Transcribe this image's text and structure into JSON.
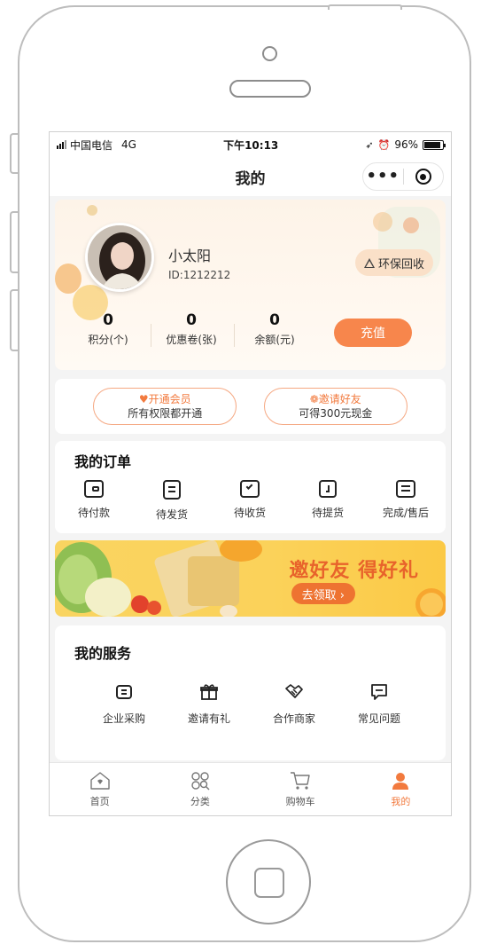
{
  "statusbar": {
    "carrier": "中国电信",
    "network": "4G",
    "time": "下午10:13",
    "battery": "96%"
  },
  "navbar": {
    "title": "我的",
    "more": "•••"
  },
  "profile": {
    "name": "小太阳",
    "id": "ID:1212212",
    "eco_button": "环保回收",
    "stats": [
      {
        "value": "0",
        "label": "积分(个)"
      },
      {
        "value": "0",
        "label": "优惠卷(张)"
      },
      {
        "value": "0",
        "label": "余额(元)"
      }
    ],
    "recharge": "充值"
  },
  "promos": [
    {
      "title": "♥开通会员",
      "subtitle": "所有权限都开通"
    },
    {
      "title": "❁邀请好友",
      "subtitle": "可得300元现金"
    }
  ],
  "orders": {
    "title": "我的订单",
    "items": [
      {
        "label": "待付款",
        "icon": "wallet-icon"
      },
      {
        "label": "待发货",
        "icon": "list-icon"
      },
      {
        "label": "待收货",
        "icon": "receive-box-icon"
      },
      {
        "label": "待提货",
        "icon": "pickup-icon"
      },
      {
        "label": "完成/售后",
        "icon": "after-sale-icon"
      }
    ]
  },
  "banner": {
    "title": "邀好友 得好礼",
    "button": "去领取 ›"
  },
  "services": {
    "title": "我的服务",
    "items": [
      {
        "label": "企业采购",
        "icon": "purchase-icon"
      },
      {
        "label": "邀请有礼",
        "icon": "gift-icon"
      },
      {
        "label": "合作商家",
        "icon": "handshake-icon"
      },
      {
        "label": "常见问题",
        "icon": "faq-icon"
      }
    ]
  },
  "tabbar": [
    {
      "label": "首页",
      "icon": "home-icon"
    },
    {
      "label": "分类",
      "icon": "category-icon"
    },
    {
      "label": "购物车",
      "icon": "cart-icon"
    },
    {
      "label": "我的",
      "icon": "user-icon",
      "active": true
    }
  ],
  "colors": {
    "accent": "#f7864c",
    "accent_text": "#f27a3e",
    "eco_bg": "#fae0c8",
    "banner_bg": "#fbd25a"
  }
}
